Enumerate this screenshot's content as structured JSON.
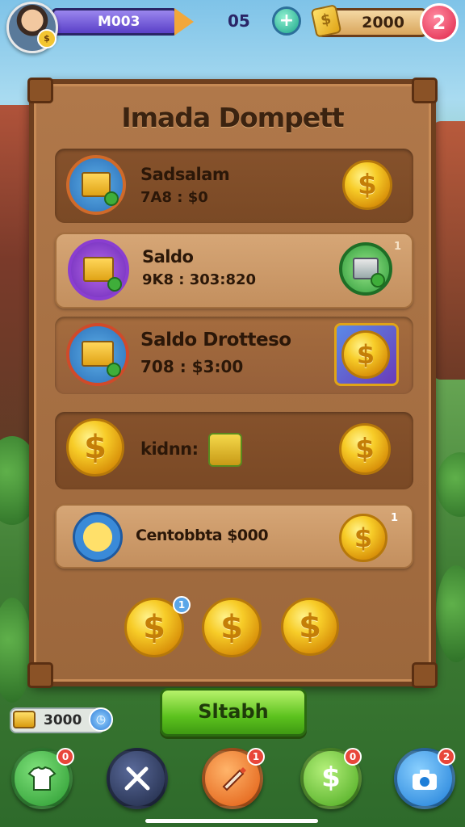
{
  "header": {
    "player_name": "M003",
    "level": "05",
    "plus": "+",
    "gold": "2000",
    "gold_icon": "$",
    "notifications": "2",
    "avatar_badge": "$"
  },
  "panel": {
    "title": "Imada Dompett",
    "rows": [
      {
        "title": "Sadsalam",
        "subtitle": "7A8 : $0",
        "coin": "$"
      },
      {
        "title": "Saldo",
        "subtitle": "9K8 : 303:820",
        "badge": "1"
      },
      {
        "title": "Saldo Drotteso",
        "subtitle": "708 : $3:00",
        "coin": "$"
      },
      {
        "title": "kidnn:",
        "coin_left": "$",
        "coin_right": "$"
      },
      {
        "title": "Centobbta $000",
        "coin": "$",
        "badge": "1"
      }
    ],
    "bottom_coins": [
      {
        "label": "$",
        "badge": "1"
      },
      {
        "label": "$"
      },
      {
        "label": "$"
      }
    ]
  },
  "action_button": "Sltabh",
  "balance": "3000",
  "nav": [
    {
      "name": "shop",
      "icon": "shirt-icon",
      "badge": "0",
      "color": "#3fb24a"
    },
    {
      "name": "battle",
      "icon": "swords-icon",
      "color": "#2f3a5a"
    },
    {
      "name": "craft",
      "icon": "brush-icon",
      "badge": "1",
      "color": "#ee7a26"
    },
    {
      "name": "wallet",
      "icon": "dollar-icon",
      "glyph": "$",
      "badge": "0",
      "color": "#7ccf3a"
    },
    {
      "name": "camera",
      "icon": "camera-icon",
      "badge": "2",
      "color": "#3aa0e8"
    }
  ]
}
